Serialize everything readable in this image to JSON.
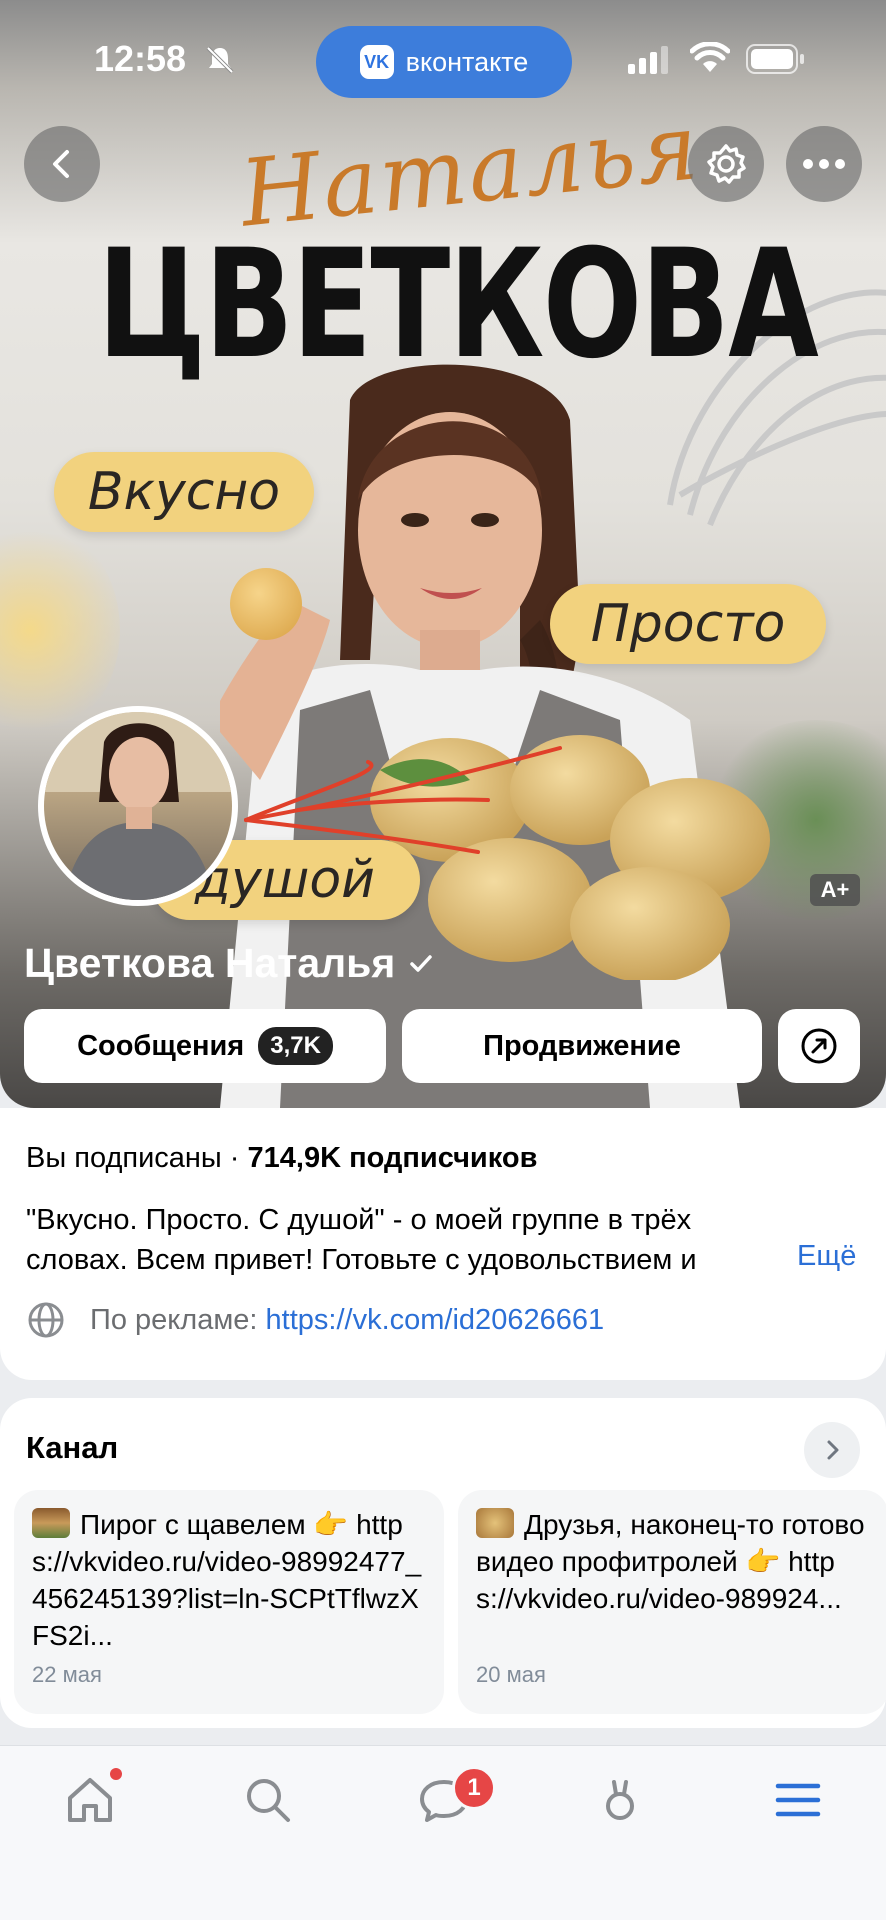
{
  "status_bar": {
    "time": "12:58",
    "app_pill": "вконтакте",
    "vk_logo": "VK"
  },
  "cover": {
    "script_title": "Наталья",
    "big_title": "ЦВЕТКОВА",
    "pill_1": "Вкусно",
    "pill_2": "Просто",
    "pill_3": "душой",
    "age_badge": "A+"
  },
  "profile": {
    "name": "Цветкова Наталья",
    "messages_label": "Сообщения",
    "messages_count": "3,7K",
    "promo_label": "Продвижение"
  },
  "info": {
    "subscribed": "Вы подписаны · ",
    "followers": "714,9K подписчиков",
    "description_line1": "\"Вкусно. Просто. С душой\" - о моей группе в трёх",
    "description_line2": "словах. Всем привет! Готовьте с удовольствием и",
    "more": "Ещё",
    "ad_label": "По рекламе:",
    "ad_link": "https://vk.com/id20626661"
  },
  "channel": {
    "title": "Канал",
    "posts": [
      {
        "text": "Пирог с щавелем 👉 https://vkvideo.ru/video-98992477_456245139?list=ln-SCPtTflwzXFS2i...",
        "date": "22 мая"
      },
      {
        "text": "Друзья, наконец-то готово видео профитролей 👉 https://vkvideo.ru/video-989924...",
        "date": "20 мая"
      }
    ]
  },
  "tabbar": {
    "chat_badge": "1"
  },
  "colors": {
    "accent": "#2b6fd6",
    "vk_blue": "#3d7ddb",
    "pill_yellow": "#f2d27e",
    "badge_red": "#e64646"
  }
}
